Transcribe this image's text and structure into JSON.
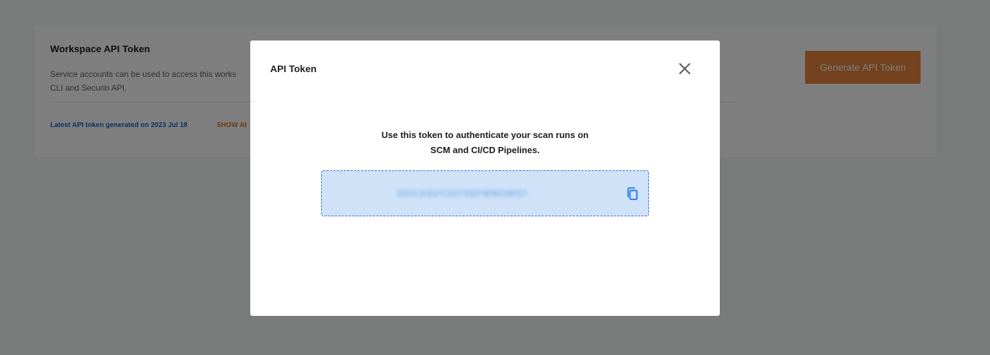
{
  "workspace_card": {
    "title": "Workspace API Token",
    "description": "Service accounts can be used to access this workspace using the CLI and Securin API.",
    "description_visible_line1": "Service accounts can be used to access this works",
    "description_visible_line2": "CLI and Securin API.",
    "latest_token_text": "Latest API token generated on 2023 Jul 18",
    "show_link_text": "SHOW AI",
    "generate_button_label": "Generate API Token"
  },
  "modal": {
    "title": "API Token",
    "close_icon": "close-icon",
    "message_line1": "Use this token to authenticate your scan runs on",
    "message_line2": "SCM and CI/CD Pipelines.",
    "token_value": "DGCA2UY247SEFWMOMS7",
    "copy_icon": "copy-icon"
  },
  "colors": {
    "accent_orange": "#e8843c",
    "link_blue": "#1f5fbf",
    "token_bg": "#cfe2f8",
    "token_border": "#2f6fcf",
    "copy_icon": "#1a73e8"
  }
}
